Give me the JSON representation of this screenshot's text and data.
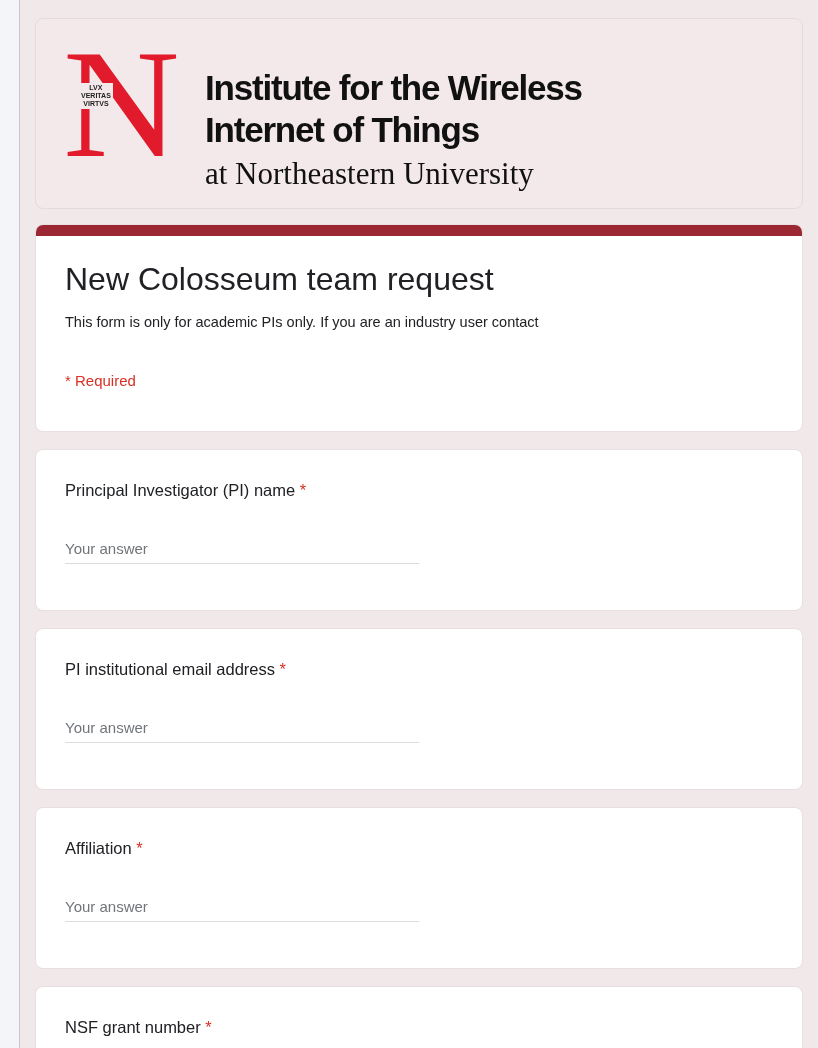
{
  "header": {
    "logo_letter": "N",
    "motto": [
      "LVX",
      "VERITAS",
      "VIRTVS"
    ],
    "title_lines": [
      "Institute for the Wireless",
      "Internet of Things"
    ],
    "subtitle": "at Northeastern University"
  },
  "form": {
    "title": "New Colosseum team request",
    "description": "This form is only for academic PIs only. If you are an industry user contact",
    "required_note": "* Required",
    "required_mark": "*"
  },
  "questions": [
    {
      "label": "Principal Investigator (PI) name",
      "required": true,
      "placeholder": "Your answer"
    },
    {
      "label": "PI institutional email address",
      "required": true,
      "placeholder": "Your answer"
    },
    {
      "label": "Affiliation",
      "required": true,
      "placeholder": "Your answer"
    },
    {
      "label": "NSF grant number",
      "required": true
    }
  ]
}
